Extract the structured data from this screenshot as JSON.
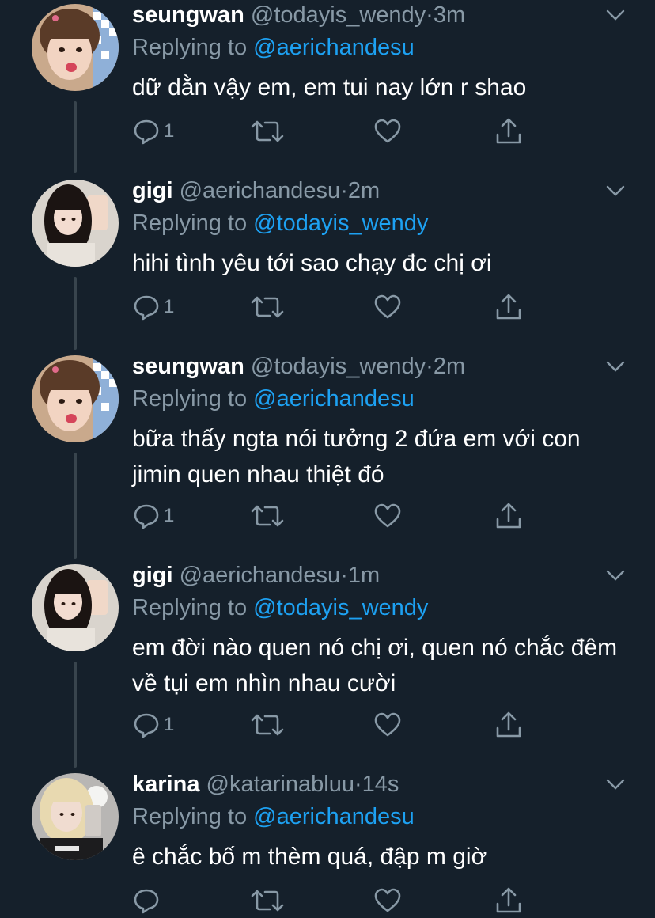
{
  "tweets": [
    {
      "name": "seungwan",
      "handle": "@todayis_wendy",
      "sep": "·",
      "time": "3m",
      "replying_prefix": "Replying to",
      "replying_to": "@aerichandesu",
      "text": "dữ dằn vậy em, em tui nay lớn r shao",
      "reply_count": "1",
      "avatar": "seungwan-avatar"
    },
    {
      "name": "gigi",
      "handle": "@aerichandesu",
      "sep": "·",
      "time": "2m",
      "replying_prefix": "Replying to",
      "replying_to": "@todayis_wendy",
      "text": "hihi tình yêu tới sao chạy đc chị ơi",
      "reply_count": "1",
      "avatar": "gigi-avatar"
    },
    {
      "name": "seungwan",
      "handle": "@todayis_wendy",
      "sep": "·",
      "time": "2m",
      "replying_prefix": "Replying to",
      "replying_to": "@aerichandesu",
      "text": "bữa thấy ngta nói tưởng 2 đứa em với con jimin quen nhau thiệt đó",
      "reply_count": "1",
      "avatar": "seungwan-avatar"
    },
    {
      "name": "gigi",
      "handle": "@aerichandesu",
      "sep": "·",
      "time": "1m",
      "replying_prefix": "Replying to",
      "replying_to": "@todayis_wendy",
      "text": "em đời nào quen nó chị ơi, quen nó chắc đêm về tụi em nhìn nhau cười",
      "reply_count": "1",
      "avatar": "gigi-avatar"
    },
    {
      "name": "karina",
      "handle": "@katarinabluu",
      "sep": "·",
      "time": "14s",
      "replying_prefix": "Replying to",
      "replying_to": "@aerichandesu",
      "text": "ê chắc bố m thèm quá, đập m giờ",
      "reply_count": "",
      "avatar": "karina-avatar"
    }
  ],
  "colors": {
    "background": "#15202b",
    "secondary_text": "#8899a6",
    "link": "#1da1f2",
    "thread_line": "#38444d"
  },
  "icons": [
    "reply-icon",
    "retweet-icon",
    "like-icon",
    "share-icon",
    "chevron-down-icon"
  ]
}
